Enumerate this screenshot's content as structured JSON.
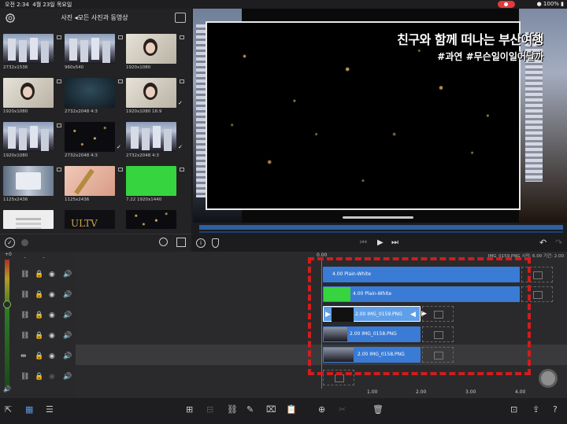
{
  "status": {
    "time": "오전 2:34",
    "date": "4월 23일 목요일",
    "battery": "100%"
  },
  "browser": {
    "title": "사진 ◂모든 사진과 동영상",
    "items": [
      {
        "label": "2732x1536"
      },
      {
        "label": "960x540"
      },
      {
        "label": "1920x1080"
      },
      {
        "label": "1920x1080"
      },
      {
        "label": "2732x2048  4:3"
      },
      {
        "label": "1920x1080  16:9"
      },
      {
        "label": "1920x1080"
      },
      {
        "label": "2732x2048  4:3"
      },
      {
        "label": "2732x2048  4:3"
      },
      {
        "label": "1125x2436"
      },
      {
        "label": "1125x2436"
      },
      {
        "label": "7.22  1920x1440"
      },
      {
        "label": ""
      },
      {
        "label": ""
      },
      {
        "label": ""
      }
    ]
  },
  "preview": {
    "title_text": "친구와 함께 떠나는 부산여행",
    "tags_text": "#과연 #무슨일이일어날까"
  },
  "timeline": {
    "start": "0.00",
    "info": "IMG_0159.PNG 시작: 6.00 기간: 2.00",
    "clips": [
      {
        "label": "4.00   Plain-White"
      },
      {
        "label": "4.00   Plain-White"
      },
      {
        "label": "2.00   IMG_0159.PNG"
      },
      {
        "label": "2.00   IMG_0158.PNG"
      },
      {
        "label": "2.00   IMG_0158.PNG"
      }
    ],
    "ticks": [
      "1.00",
      "2.00",
      "3.00",
      "4.00"
    ]
  }
}
